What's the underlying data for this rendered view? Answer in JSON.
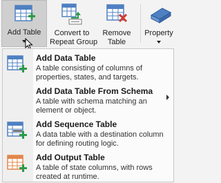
{
  "ribbon": {
    "add_table": {
      "label": "Add Table"
    },
    "convert": {
      "label_line1": "Convert to",
      "label_line2": "Repeat Group"
    },
    "remove": {
      "label_line1": "Remove",
      "label_line2": "Table"
    },
    "property": {
      "label": "Property"
    }
  },
  "menu": {
    "items": [
      {
        "title": "Add Data Table",
        "description": "A table consisting of columns of properties, states, and targets."
      },
      {
        "title": "Add Data Table From Schema",
        "description": "A table with schema matching an element or object."
      },
      {
        "title": "Add Sequence Table",
        "description": "A data table with a destination column for defining routing logic."
      },
      {
        "title": "Add Output Table",
        "description": "A table of state columns, with rows created at runtime."
      }
    ]
  },
  "colors": {
    "green_plus": "#2e9a46",
    "table_blue": "#4f80c2",
    "remove_red": "#d33b30",
    "output_orange": "#e2874a"
  }
}
